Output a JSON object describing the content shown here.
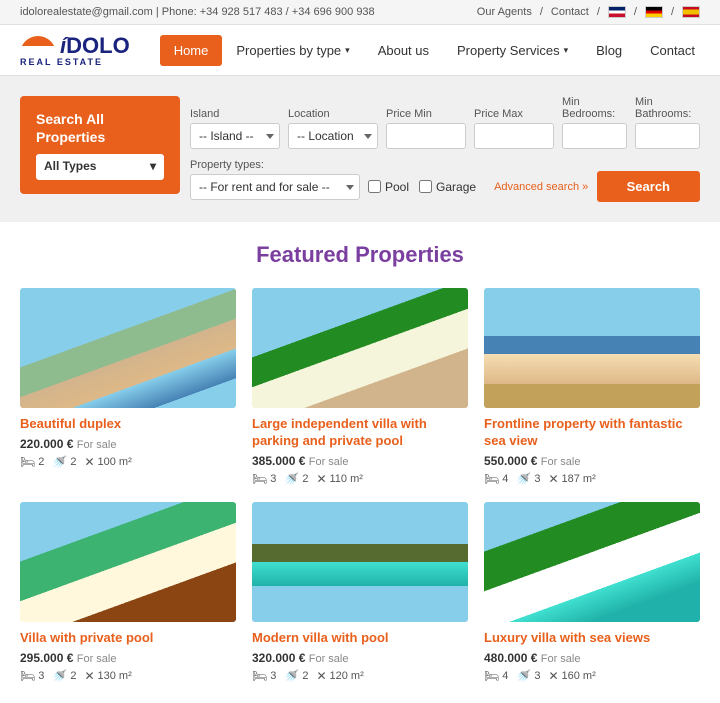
{
  "topbar": {
    "contact_info": "idolorealestate@gmail.com  |  Phone: +34 928 517 483 / +34 696 900 938",
    "links": [
      "Our Agents",
      "Contact"
    ],
    "flags": [
      "UK",
      "DE",
      "ES"
    ]
  },
  "header": {
    "logo": {
      "brand": "íDOLO",
      "sub": "REAL ESTATE"
    },
    "nav": [
      {
        "label": "Home",
        "active": true,
        "has_arrow": false
      },
      {
        "label": "Properties by type",
        "active": false,
        "has_arrow": true
      },
      {
        "label": "About us",
        "active": false,
        "has_arrow": false
      },
      {
        "label": "Property Services",
        "active": false,
        "has_arrow": true
      },
      {
        "label": "Blog",
        "active": false,
        "has_arrow": false
      },
      {
        "label": "Contact",
        "active": false,
        "has_arrow": false
      }
    ]
  },
  "search": {
    "box_title": "Search All Properties",
    "all_types_label": "All Types",
    "island_label": "Island",
    "island_default": "-- Island --",
    "location_label": "Location",
    "location_default": "-- Location --",
    "price_min_label": "Price Min",
    "price_min_placeholder": "",
    "price_max_label": "Price Max",
    "price_max_placeholder": "",
    "min_bedrooms_label": "Min Bedrooms:",
    "min_bathrooms_label": "Min Bathrooms:",
    "property_types_label": "Property types:",
    "property_types_default": "-- For rent and for sale --",
    "pool_label": "Pool",
    "garage_label": "Garage",
    "advanced_link": "Advanced search »",
    "search_btn": "Search"
  },
  "featured": {
    "title": "Featured Properties",
    "properties": [
      {
        "id": 1,
        "title": "Beautiful duplex",
        "price": "220.000 €",
        "status": "For sale",
        "bedrooms": 2,
        "bathrooms": 2,
        "area": "100 m²",
        "img_class": "img-pool"
      },
      {
        "id": 2,
        "title": "Large independent villa with parking and private pool",
        "price": "385.000 €",
        "status": "For sale",
        "bedrooms": 3,
        "bathrooms": 2,
        "area": "110 m²",
        "img_class": "img-villa"
      },
      {
        "id": 3,
        "title": "Frontline property with fantastic sea view",
        "price": "550.000 €",
        "status": "For sale",
        "bedrooms": 4,
        "bathrooms": 3,
        "area": "187 m²",
        "img_class": "img-beach"
      },
      {
        "id": 4,
        "title": "Villa with private pool",
        "price": "295.000 €",
        "status": "For sale",
        "bedrooms": 3,
        "bathrooms": 2,
        "area": "130 m²",
        "img_class": "img-house1"
      },
      {
        "id": 5,
        "title": "Modern villa with pool",
        "price": "320.000 €",
        "status": "For sale",
        "bedrooms": 3,
        "bathrooms": 2,
        "area": "120 m²",
        "img_class": "img-pool2"
      },
      {
        "id": 6,
        "title": "Luxury villa with sea views",
        "price": "480.000 €",
        "status": "For sale",
        "bedrooms": 4,
        "bathrooms": 3,
        "area": "160 m²",
        "img_class": "img-villa2"
      }
    ]
  }
}
